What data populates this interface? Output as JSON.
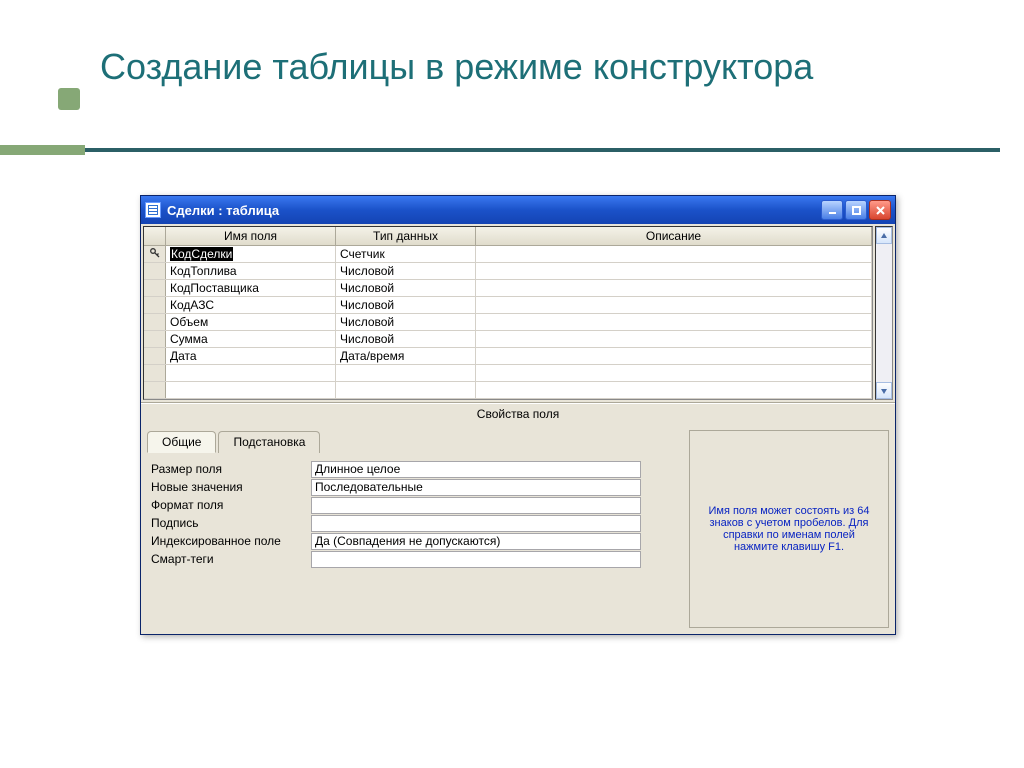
{
  "slide": {
    "title": "Создание таблицы в режиме конструктора"
  },
  "window": {
    "title": "Сделки : таблица",
    "properties_label": "Свойства поля"
  },
  "grid": {
    "headers": {
      "field_name": "Имя поля",
      "data_type": "Тип данных",
      "description": "Описание"
    },
    "rows": [
      {
        "key": true,
        "current": true,
        "name": "КодСделки",
        "type": "Счетчик",
        "desc": ""
      },
      {
        "key": false,
        "current": false,
        "name": "КодТоплива",
        "type": "Числовой",
        "desc": ""
      },
      {
        "key": false,
        "current": false,
        "name": "КодПоставщика",
        "type": "Числовой",
        "desc": ""
      },
      {
        "key": false,
        "current": false,
        "name": "КодАЗС",
        "type": "Числовой",
        "desc": ""
      },
      {
        "key": false,
        "current": false,
        "name": "Объем",
        "type": "Числовой",
        "desc": ""
      },
      {
        "key": false,
        "current": false,
        "name": "Сумма",
        "type": "Числовой",
        "desc": ""
      },
      {
        "key": false,
        "current": false,
        "name": "Дата",
        "type": "Дата/время",
        "desc": ""
      },
      {
        "key": false,
        "current": false,
        "name": "",
        "type": "",
        "desc": ""
      },
      {
        "key": false,
        "current": false,
        "name": "",
        "type": "",
        "desc": ""
      }
    ]
  },
  "tabs": {
    "general": "Общие",
    "lookup": "Подстановка"
  },
  "properties": [
    {
      "label": "Размер поля",
      "value": "Длинное целое"
    },
    {
      "label": "Новые значения",
      "value": "Последовательные"
    },
    {
      "label": "Формат поля",
      "value": ""
    },
    {
      "label": "Подпись",
      "value": ""
    },
    {
      "label": "Индексированное поле",
      "value": "Да (Совпадения не допускаются)"
    },
    {
      "label": "Смарт-теги",
      "value": ""
    }
  ],
  "help": {
    "text": "Имя поля может состоять из 64 знаков с учетом пробелов.  Для справки по именам полей нажмите клавишу F1."
  }
}
